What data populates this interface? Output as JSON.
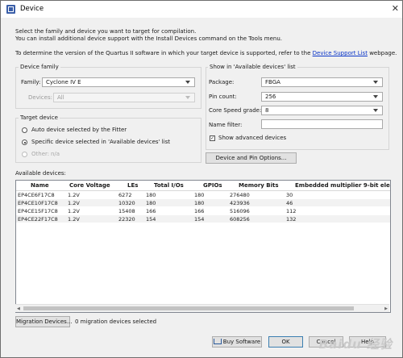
{
  "window": {
    "title": "Device",
    "close_glyph": "✕"
  },
  "intro": {
    "line1": "Select the family and device you want to target for compilation.",
    "line2": "You can install additional device support with the Install Devices command on the Tools menu.",
    "line3_prefix": "To determine the version of the Quartus II software in which your target device is supported, refer to the",
    "line3_link": "Device Support List",
    "line3_suffix": "webpage."
  },
  "device_family": {
    "group_label": "Device family",
    "family_label": "Family:",
    "family_value": "Cyclone IV E",
    "devices_label": "Devices:",
    "devices_value": "All"
  },
  "target_device": {
    "group_label": "Target device",
    "option_auto": "Auto device selected by the Fitter",
    "option_specific": "Specific device selected in 'Available devices' list",
    "option_other": "Other:",
    "option_other_value": "n/a",
    "selected": "specific"
  },
  "show_in_list": {
    "group_label": "Show in 'Available devices' list",
    "package_label": "Package:",
    "package_value": "FBGA",
    "pin_count_label": "Pin count:",
    "pin_count_value": "256",
    "speed_label": "Core Speed grade:",
    "speed_value": "8",
    "name_filter_label": "Name filter:",
    "name_filter_value": "",
    "show_advanced_label": "Show advanced devices",
    "show_advanced_checked": true,
    "device_pin_options_button": "Device and Pin Options..."
  },
  "available_devices": {
    "label": "Available devices:",
    "columns": [
      "Name",
      "Core Voltage",
      "LEs",
      "Total I/Os",
      "GPIOs",
      "Memory Bits",
      "Embedded multiplier 9-bit ele"
    ],
    "rows": [
      [
        "EP4CE6F17C8",
        "1.2V",
        "6272",
        "180",
        "180",
        "276480",
        "30"
      ],
      [
        "EP4CE10F17C8",
        "1.2V",
        "10320",
        "180",
        "180",
        "423936",
        "46"
      ],
      [
        "EP4CE15F17C8",
        "1.2V",
        "15408",
        "166",
        "166",
        "516096",
        "112"
      ],
      [
        "EP4CE22F17C8",
        "1.2V",
        "22320",
        "154",
        "154",
        "608256",
        "132"
      ]
    ]
  },
  "migration": {
    "button": "Migration Devices...",
    "status": "0 migration devices selected"
  },
  "footer": {
    "buy_icon": "cart-icon",
    "buy_label": "Buy Software",
    "ok_label": "OK",
    "cancel_label": "Cancel",
    "help_label": "Help"
  },
  "watermark": "Baidu 经验"
}
